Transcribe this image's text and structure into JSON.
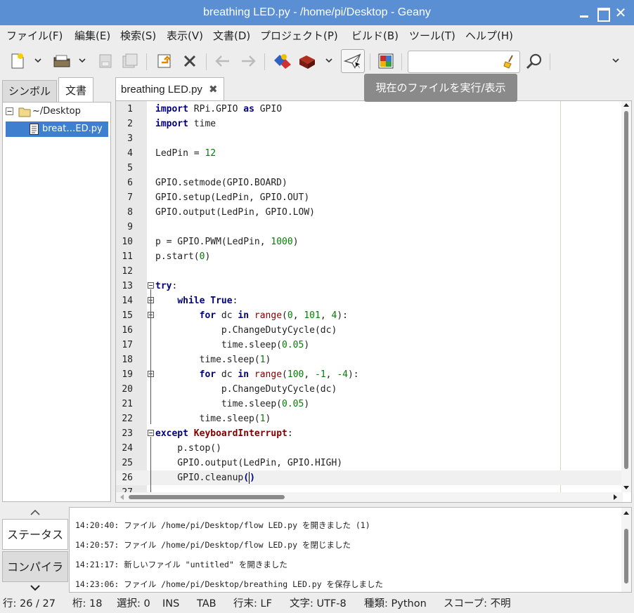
{
  "window": {
    "title": "breathing LED.py - /home/pi/Desktop - Geany",
    "close_glyph": "✕"
  },
  "menu": [
    "ファイル(F)",
    "編集(E)",
    "検索(S)",
    "表示(V)",
    "文書(D)",
    "プロジェクト(P)",
    "ビルド(B)",
    "ツール(T)",
    "ヘルプ(H)"
  ],
  "toolbar": {
    "icons": [
      "new-file-icon",
      "open-file-icon",
      "save-icon",
      "save-all-icon",
      "revert-icon",
      "close-file-icon",
      "back-icon",
      "forward-icon",
      "compile-icon",
      "build-icon",
      "execute-icon",
      "color-chooser-icon",
      "clear-icon",
      "find-icon"
    ],
    "search_value": "",
    "tooltip": "現在のファイルを実行/表示"
  },
  "sidebar": {
    "tabs": [
      "シンボル",
      "文書"
    ],
    "active_tab": 1,
    "tree": {
      "folder": "~/Desktop",
      "file": "breat…ED.py"
    }
  },
  "editor": {
    "tab_label": "breathing LED.py",
    "tab_close": "✖",
    "lines": [
      {
        "n": "1",
        "html": "<span class=\"kw\">import</span> RPi.GPIO <span class=\"kw\">as</span> GPIO"
      },
      {
        "n": "2",
        "html": "<span class=\"kw\">import</span> time"
      },
      {
        "n": "3",
        "html": ""
      },
      {
        "n": "4",
        "html": "LedPin = <span class=\"num\">12</span>"
      },
      {
        "n": "5",
        "html": ""
      },
      {
        "n": "6",
        "html": "GPIO.setmode(GPIO.BOARD)"
      },
      {
        "n": "7",
        "html": "GPIO.setup(LedPin, GPIO.OUT)"
      },
      {
        "n": "8",
        "html": "GPIO.output(LedPin, GPIO.LOW)"
      },
      {
        "n": "9",
        "html": ""
      },
      {
        "n": "10",
        "html": "p = GPIO.PWM(LedPin, <span class=\"num\">1000</span>)"
      },
      {
        "n": "11",
        "html": "p.start(<span class=\"num\">0</span>)"
      },
      {
        "n": "12",
        "html": ""
      },
      {
        "n": "13",
        "html": "<span class=\"kw\">try</span>:"
      },
      {
        "n": "14",
        "html": "    <span class=\"kw\">while</span> <span class=\"kw\">True</span>:"
      },
      {
        "n": "15",
        "html": "        <span class=\"kw\">for</span> dc <span class=\"kw\">in</span> <span class=\"fn\">range</span>(<span class=\"num\">0</span>, <span class=\"num\">101</span>, <span class=\"num\">4</span>):"
      },
      {
        "n": "16",
        "html": "            p.ChangeDutyCycle(dc)"
      },
      {
        "n": "17",
        "html": "            time.sleep(<span class=\"num\">0.05</span>)"
      },
      {
        "n": "18",
        "html": "        time.sleep(<span class=\"num\">1</span>)"
      },
      {
        "n": "19",
        "html": "        <span class=\"kw\">for</span> dc <span class=\"kw\">in</span> <span class=\"fn\">range</span>(<span class=\"num\">100</span>, <span class=\"num\">-1</span>, <span class=\"num\">-4</span>):"
      },
      {
        "n": "20",
        "html": "            p.ChangeDutyCycle(dc)"
      },
      {
        "n": "21",
        "html": "            time.sleep(<span class=\"num\">0.05</span>)"
      },
      {
        "n": "22",
        "html": "        time.sleep(<span class=\"num\">1</span>)"
      },
      {
        "n": "23",
        "html": "<span class=\"kw\">except</span> <span class=\"cls\">KeyboardInterrupt</span>:"
      },
      {
        "n": "24",
        "html": "    p.stop()"
      },
      {
        "n": "25",
        "html": "    GPIO.output(LedPin, GPIO.HIGH)"
      },
      {
        "n": "26",
        "html": "    GPIO.cleanup<span class=\"kw\">(</span><span class=\"caret\"></span><span class=\"kw\">)</span>"
      },
      {
        "n": "27",
        "html": ""
      }
    ],
    "fold_lines": [
      13,
      14,
      15,
      19,
      23
    ],
    "current_line": 26
  },
  "messages": {
    "tabs": [
      "ステータス",
      "コンパイラ"
    ],
    "lines": [
      "14:20:40: ファイル /home/pi/Desktop/flow LED.py を開きました (1)",
      "14:20:57: ファイル /home/pi/Desktop/flow LED.py を閉じました",
      "14:21:17: 新しいファイル \"untitled\" を開きました",
      "14:23:06: ファイル /home/pi/Desktop/breathing LED.py を保存しました"
    ]
  },
  "status": {
    "line": "行: 26 / 27",
    "col": "桁: 18",
    "sel": "選択: 0",
    "mode": "INS",
    "indent": "TAB",
    "eol": "行末: LF",
    "encoding": "文字: UTF-8",
    "filetype": "種類: Python",
    "scope": "スコープ: 不明"
  }
}
